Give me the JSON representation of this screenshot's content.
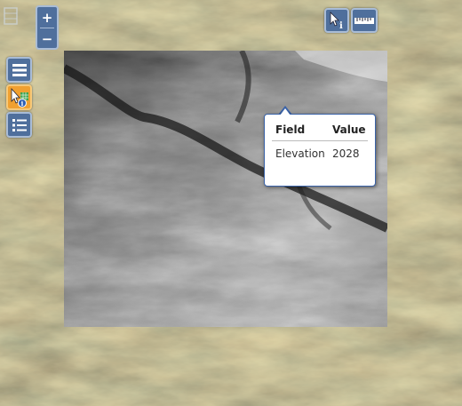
{
  "map": {
    "basemap": "satellite-imagery",
    "overlay": "elevation-hillshade-grayscale"
  },
  "zoom": {
    "in_label": "+",
    "out_label": "−"
  },
  "toolbar": {
    "identify_icon": "identify-cursor-icon",
    "measure_icon": "ruler-icon",
    "layers_icon": "menu-icon",
    "pick_icon": "feature-info-icon",
    "legend_icon": "checklist-icon"
  },
  "popup": {
    "header_field": "Field",
    "header_value": "Value",
    "rows": [
      {
        "field": "Elevation",
        "value": "2028"
      }
    ]
  },
  "colors": {
    "button": "#4f6f9c",
    "button_border": "#a9bcd6",
    "popup_border": "#3b63a8"
  }
}
